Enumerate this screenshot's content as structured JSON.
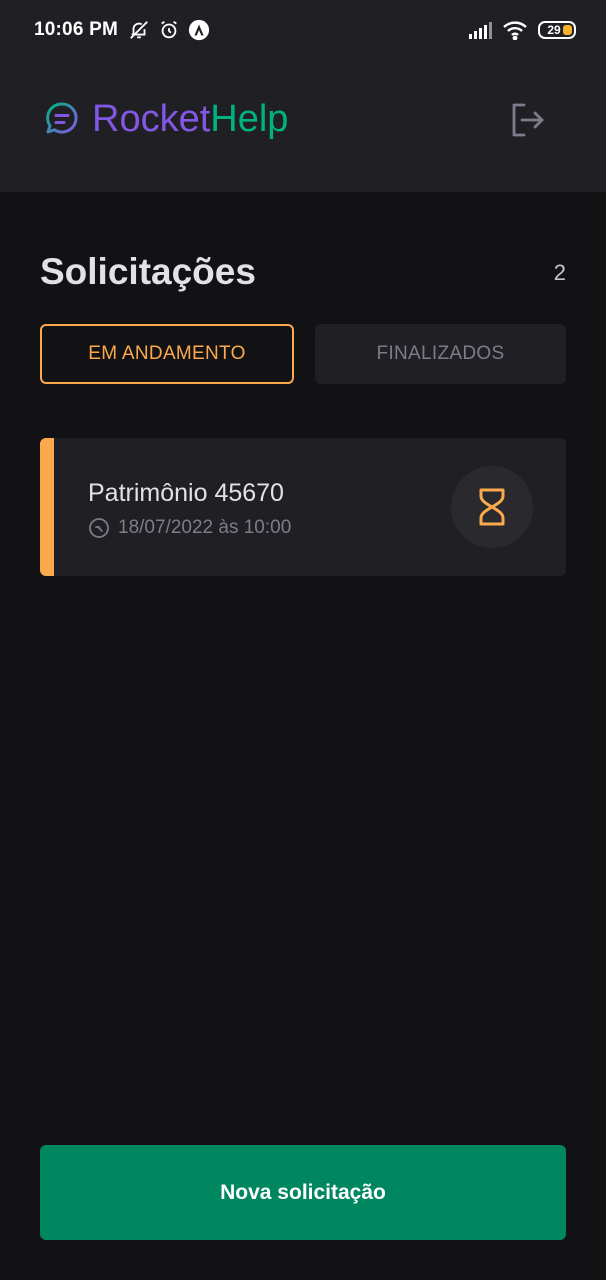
{
  "status_bar": {
    "time": "10:06 PM",
    "battery": "29",
    "icons": [
      "notifications-off-icon",
      "alarm-icon",
      "app-notification-icon",
      "signal-icon",
      "wifi-icon",
      "battery-icon"
    ]
  },
  "header": {
    "brand_part1": "Rocket",
    "brand_part2": "Help",
    "logo_icon": "chat-bubble-icon",
    "logout_icon": "sign-out-icon"
  },
  "main": {
    "title": "Solicitações",
    "count": "2",
    "filters": [
      {
        "label": "EM ANDAMENTO",
        "active": true
      },
      {
        "label": "FINALIZADOS",
        "active": false
      }
    ],
    "orders": [
      {
        "title": "Patrimônio 45670",
        "when": "18/07/2022 às 10:00",
        "status": "open",
        "status_icon": "hourglass-icon",
        "clock_icon": "clock-icon"
      }
    ]
  },
  "footer": {
    "new_button_label": "Nova solicitação"
  },
  "colors": {
    "background": "#121214",
    "surface": "#202024",
    "brand_purple": "#8257e5",
    "brand_green": "#00b37e",
    "accent_open": "#fba94c",
    "button_green": "#00875f"
  }
}
